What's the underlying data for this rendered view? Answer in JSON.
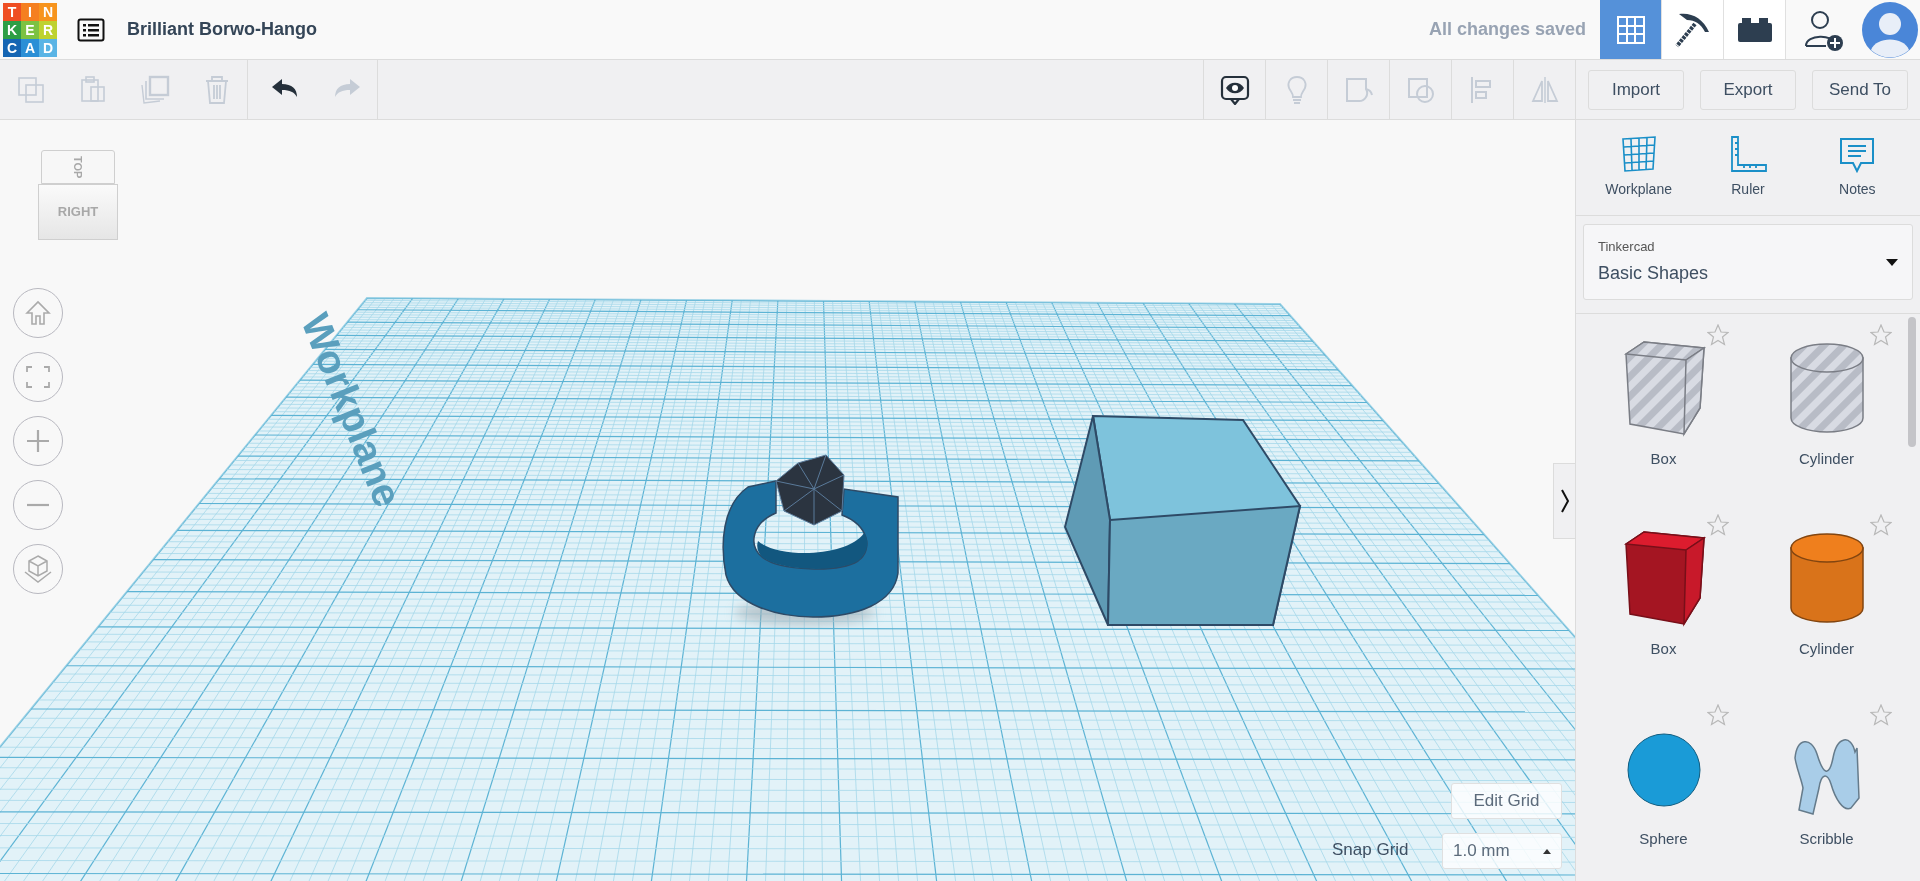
{
  "logo": {
    "letters": [
      {
        "char": "T",
        "color": "#ef4e23"
      },
      {
        "char": "I",
        "color": "#f57f20"
      },
      {
        "char": "N",
        "color": "#f7941d"
      },
      {
        "char": "K",
        "color": "#2e9e45"
      },
      {
        "char": "E",
        "color": "#7cc242"
      },
      {
        "char": "R",
        "color": "#bed230"
      },
      {
        "char": "C",
        "color": "#1565b3"
      },
      {
        "char": "A",
        "color": "#2a8fd6"
      },
      {
        "char": "D",
        "color": "#5ab4e5"
      }
    ]
  },
  "title": "Brilliant Borwo-Hango",
  "save_status": "All changes saved",
  "view_buttons": [
    {
      "kind": "grid",
      "selected": true
    },
    {
      "kind": "pickaxe",
      "selected": false
    },
    {
      "kind": "bricks",
      "selected": false
    }
  ],
  "edit_tools": [
    {
      "kind": "copy",
      "disabled": true
    },
    {
      "kind": "paste",
      "disabled": true
    },
    {
      "kind": "duplicate",
      "disabled": true
    },
    {
      "kind": "delete",
      "disabled": true
    },
    {
      "kind": "undo",
      "disabled": false
    },
    {
      "kind": "redo",
      "disabled": true
    }
  ],
  "view_tools": [
    {
      "kind": "eye",
      "disabled": false
    },
    {
      "kind": "bulb",
      "disabled": true
    },
    {
      "kind": "group",
      "disabled": true
    },
    {
      "kind": "ungroup",
      "disabled": true
    },
    {
      "kind": "align",
      "disabled": true
    },
    {
      "kind": "mirror",
      "disabled": true
    }
  ],
  "actions": [
    "Import",
    "Export",
    "Send To"
  ],
  "view_cube": {
    "top": "TOP",
    "front": "RIGHT"
  },
  "workplane": {
    "label": "Workplane"
  },
  "panel": {
    "tools": [
      {
        "kind": "workplane",
        "label": "Workplane"
      },
      {
        "kind": "ruler",
        "label": "Ruler"
      },
      {
        "kind": "notes",
        "label": "Notes"
      }
    ],
    "library": {
      "label": "Tinkercad",
      "value": "Basic Shapes"
    },
    "shapes": [
      {
        "kind": "box",
        "label": "Box",
        "hole": true,
        "favorite": false
      },
      {
        "kind": "cylinder",
        "label": "Cylinder",
        "hole": true,
        "favorite": false
      },
      {
        "kind": "box",
        "label": "Box",
        "hole": false,
        "color": "#c8192a",
        "favorite": false
      },
      {
        "kind": "cylinder",
        "label": "Cylinder",
        "hole": false,
        "color": "#d9731a",
        "favorite": false
      },
      {
        "kind": "sphere",
        "label": "Sphere",
        "hole": false,
        "color": "#1a9bd7",
        "favorite": false
      },
      {
        "kind": "scribble",
        "label": "Scribble",
        "hole": false,
        "color": "#a9cde8",
        "favorite": false
      }
    ]
  },
  "grid_controls": {
    "edit_button": "Edit Grid",
    "snap_label": "Snap Grid",
    "snap_value": "1.0 mm"
  }
}
